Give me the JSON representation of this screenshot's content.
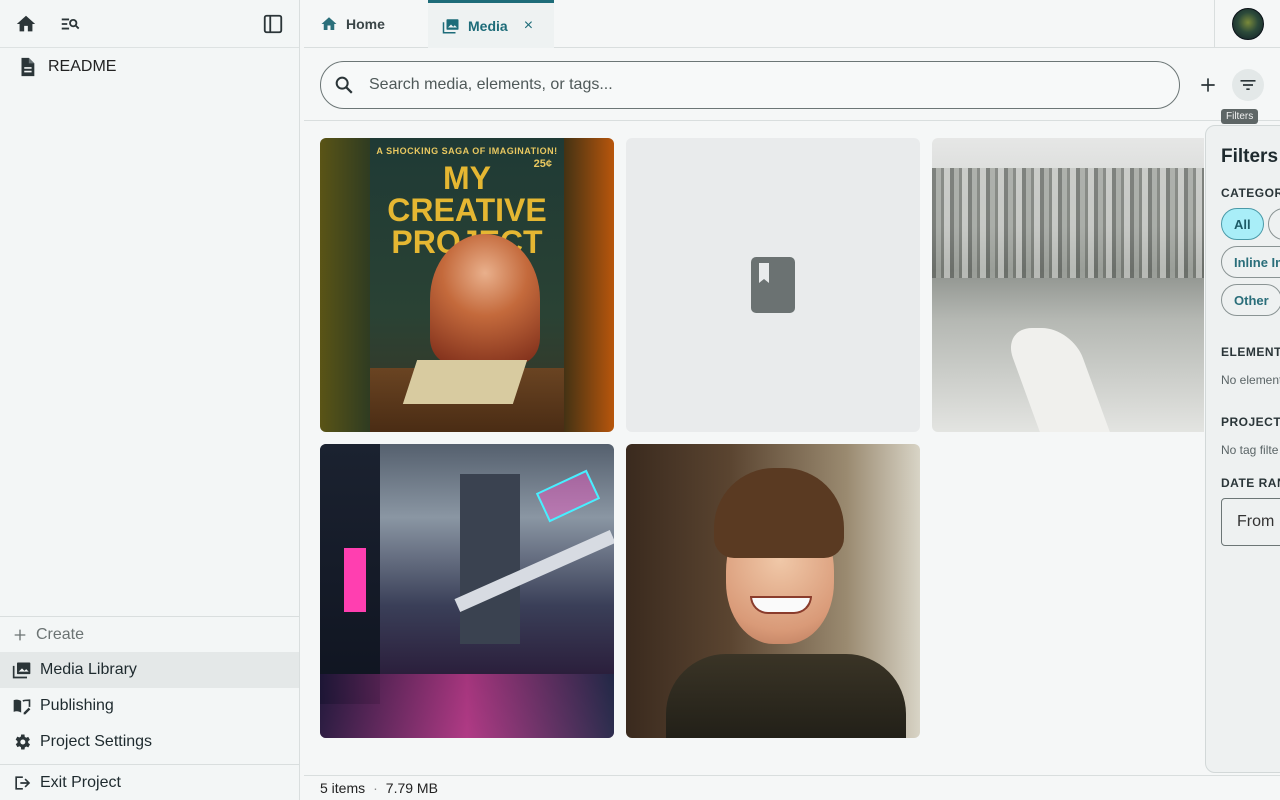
{
  "sidebar": {
    "readme_label": "README",
    "create_label": "Create",
    "nav": [
      {
        "label": "Media Library",
        "active": true
      },
      {
        "label": "Publishing"
      },
      {
        "label": "Project Settings"
      }
    ],
    "exit_label": "Exit Project"
  },
  "tabs": [
    {
      "label": "Home"
    },
    {
      "label": "Media",
      "active": true,
      "close_glyph": "×"
    }
  ],
  "search": {
    "placeholder": "Search media, elements, or tags...",
    "value": ""
  },
  "toolbar": {
    "filters_tooltip": "Filters"
  },
  "media_items": [
    {
      "kind": "image",
      "cover_top_text": "A SHOCKING SAGA OF IMAGINATION!",
      "cover_price": "25¢",
      "cover_title": "MY CREATIVE PROJECT"
    },
    {
      "kind": "placeholder",
      "icon": "book-icon"
    },
    {
      "kind": "image",
      "subject": "pencil sketch village"
    },
    {
      "kind": "image",
      "subject": "neon city"
    },
    {
      "kind": "image",
      "subject": "smiling young man"
    }
  ],
  "filters": {
    "title": "Filters",
    "category_heading": "CATEGORY",
    "chips": [
      "All",
      "",
      "Inline Im",
      "Other"
    ],
    "elements_heading": "ELEMENTS",
    "elements_empty": "No element",
    "project_heading": "PROJECT",
    "tags_empty": "No tag filte",
    "date_heading": "DATE RAN",
    "from_placeholder": "From"
  },
  "status": {
    "items": "5 items",
    "separator": "·",
    "size": "7.79 MB"
  },
  "colors": {
    "accent": "#1d6c79",
    "chip_active": "#a9eef8",
    "sidebar_bg": "#f3f6f6"
  }
}
